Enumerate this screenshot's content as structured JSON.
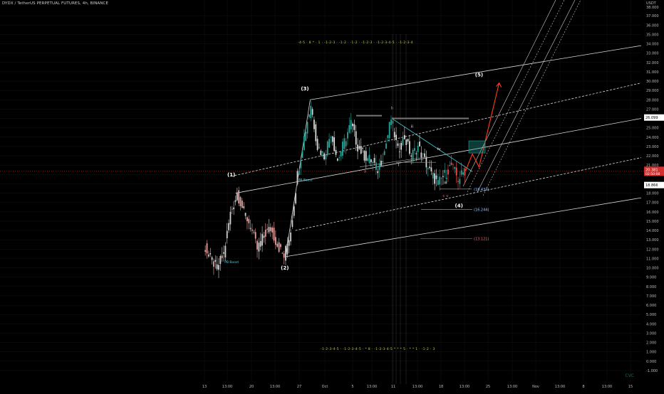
{
  "header": {
    "title": "DYDX / TetherUS PERPETUAL FUTURES, 4h, BINANCE"
  },
  "watermark": "CVC",
  "colors": {
    "bg": "#000000",
    "grid": "#141414",
    "channel": "#d8d8d8",
    "up_candle": "#26a69a",
    "down_candle": "#ef5350",
    "neutral_candle": "#cfcfcf",
    "projection": "#ff3d1f",
    "fib_box": "#26a69a",
    "price_tag": "#d32f2f",
    "wave_text": "#ffffff"
  },
  "price_axis": {
    "unit_label": "USDT",
    "top_label": "38.000",
    "ticks": [
      "-1.000",
      "0.000",
      "1.000",
      "2.000",
      "3.000",
      "4.000",
      "5.000",
      "6.000",
      "7.000",
      "8.000",
      "9.000",
      "10.000",
      "11.000",
      "12.000",
      "13.000",
      "14.000",
      "15.000",
      "16.000",
      "17.000",
      "18.000",
      "19.000",
      "20.000",
      "21.000",
      "22.000",
      "23.000",
      "24.000",
      "25.000",
      "26.000",
      "27.000",
      "28.000",
      "29.000",
      "30.000",
      "31.000",
      "32.000",
      "33.000",
      "34.000",
      "35.000",
      "36.000",
      "37.000"
    ],
    "level_26": "26.099",
    "level_18": "18.866",
    "current_price": "20.381",
    "countdown": "02:50:08"
  },
  "time_axis": {
    "ticks": [
      "13",
      "13:00",
      "20",
      "13:00",
      "27",
      "Oct",
      "5",
      "13:00",
      "11",
      "13:00",
      "18",
      "13:00",
      "25",
      "13:00",
      "Nov",
      "13:00",
      "8",
      "13:00",
      "15"
    ]
  },
  "chart_data": {
    "type": "candlestick",
    "symbol": "DYDX / TetherUS PERPETUAL FUTURES",
    "timeframe": "4h",
    "exchange": "BINANCE",
    "ylim": [
      -1,
      38
    ],
    "price_line": [
      [
        "Sep 13",
        12.5
      ],
      [
        "Sep 14",
        11.0
      ],
      [
        "Sep 15",
        10.0
      ],
      [
        "Sep 16",
        11.5
      ],
      [
        "Sep 17",
        15.8
      ],
      [
        "Sep 18",
        18.0
      ],
      [
        "Sep 19",
        16.0
      ],
      [
        "Sep 20",
        14.5
      ],
      [
        "Sep 21",
        12.0
      ],
      [
        "Sep 22",
        13.5
      ],
      [
        "Sep 23",
        14.2
      ],
      [
        "Sep 24",
        12.5
      ],
      [
        "Sep 25",
        11.2
      ],
      [
        "Sep 26",
        14.0
      ],
      [
        "Sep 27",
        20.0
      ],
      [
        "Sep 28",
        24.0
      ],
      [
        "Sep 29",
        27.5
      ],
      [
        "Sep 30",
        23.0
      ],
      [
        "Oct 1",
        22.0
      ],
      [
        "Oct 2",
        24.5
      ],
      [
        "Oct 3",
        21.5
      ],
      [
        "Oct 4",
        23.5
      ],
      [
        "Oct 5",
        25.5
      ],
      [
        "Oct 6",
        23.0
      ],
      [
        "Oct 7",
        22.0
      ],
      [
        "Oct 8",
        21.5
      ],
      [
        "Oct 9",
        20.5
      ],
      [
        "Oct 10",
        22.5
      ],
      [
        "Oct 11",
        26.0
      ],
      [
        "Oct 12",
        22.5
      ],
      [
        "Oct 13",
        24.0
      ],
      [
        "Oct 14",
        22.0
      ],
      [
        "Oct 15",
        23.0
      ],
      [
        "Oct 16",
        21.5
      ],
      [
        "Oct 17",
        20.0
      ],
      [
        "Oct 18",
        19.0
      ],
      [
        "Oct 19",
        20.0
      ],
      [
        "Oct 20",
        21.0
      ],
      [
        "Oct 21",
        19.5
      ],
      [
        "Oct 22",
        20.4
      ]
    ],
    "projection": [
      [
        "Oct 22",
        20.4
      ],
      [
        "Oct 23",
        22.2
      ],
      [
        "Oct 24",
        20.8
      ],
      [
        "Oct 27",
        29.8
      ]
    ],
    "wave_labels": [
      {
        "label": "(1)",
        "date": "Sep 17",
        "price": 19.8
      },
      {
        "label": "(2)",
        "date": "Sep 25",
        "price": 9.8
      },
      {
        "label": "(3)",
        "date": "Sep 28",
        "price": 29.0
      },
      {
        "label": "(4)",
        "date": "Oct 21",
        "price": 16.5
      },
      {
        "label": "(5)",
        "date": "Oct 24",
        "price": 30.5
      }
    ],
    "sub_labels": [
      {
        "label": "b",
        "date": "Oct 11",
        "price": 27.0
      },
      {
        "label": "ii",
        "date": "Oct 14",
        "price": 25.0
      },
      {
        "label": "iv",
        "date": "Oct 18",
        "price": 22.6
      },
      {
        "label": "i",
        "date": "Oct 12",
        "price": 20.9
      },
      {
        "label": "iii",
        "date": "Oct 19",
        "price": 19.0
      },
      {
        "label": "a",
        "date": "Oct 7",
        "price": 20.2
      },
      {
        "label": "c v",
        "date": "Oct 19",
        "price": 17.6
      }
    ],
    "targets": [
      {
        "label": "(18.437)",
        "price": 18.437
      },
      {
        "label": "(16.244)",
        "price": 16.244
      },
      {
        "label": "(13.121)",
        "price": 13.121
      }
    ],
    "boost_labels": [
      {
        "label": "PB Boost",
        "date": "Sep 16",
        "price": 10.5
      },
      {
        "label": "PB Boost",
        "date": "Sep 27",
        "price": 19.3
      }
    ],
    "pitchfork": {
      "anchors": [
        [
          "Sep 18",
          18.0
        ],
        [
          "Sep 25",
          11.2
        ],
        [
          "Sep 29",
          28.0
        ]
      ],
      "lines": [
        {
          "name": "upper",
          "start": [
            "Sep 29",
            28.0
          ],
          "end_price": 33.8
        },
        {
          "name": "mid",
          "start": [
            "Sep 25",
            11.2
          ],
          "end_price": 26.0
        },
        {
          "name": "lower",
          "start": [
            "Sep 25",
            11.2
          ],
          "end_price": 17.5
        }
      ]
    },
    "top_signal_row": "-4-5 · 8 * · 1 · -1-2-3 · -1-2 · -1-2 · -1-2-3 · -1-2-3-4-5 · -1-2-3-4",
    "bottom_signal_row": "-1-2-3-4-5 · -1-2-3-4-5 · * 8 · -1-2-3-4-5 * * * 5 · * * 1 · -1-2 · 3"
  }
}
